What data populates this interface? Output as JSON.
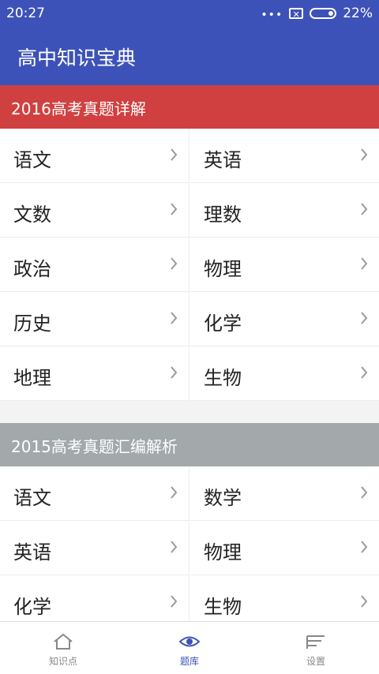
{
  "status_bar": {
    "time": "20:27",
    "battery": "22%"
  },
  "app": {
    "title": "高中知识宝典"
  },
  "sections": [
    {
      "title": "2016高考真题详解",
      "items": [
        "语文",
        "英语",
        "文数",
        "理数",
        "政治",
        "物理",
        "历史",
        "化学",
        "地理",
        "生物"
      ]
    },
    {
      "title": "2015高考真题汇编解析",
      "items": [
        "语文",
        "数学",
        "英语",
        "物理",
        "化学",
        "生物"
      ]
    }
  ],
  "bottom_nav": [
    {
      "label": "知识点",
      "icon": "home-icon",
      "active": false
    },
    {
      "label": "题库",
      "icon": "eye-icon",
      "active": true
    },
    {
      "label": "设置",
      "icon": "settings-lines-icon",
      "active": false
    }
  ],
  "colors": {
    "primary": "#3d52b8",
    "section1": "#d14040",
    "section2": "#a3a8ab"
  }
}
